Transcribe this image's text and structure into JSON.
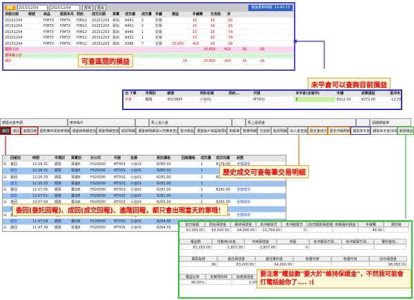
{
  "top": {
    "tag": "RE",
    "date1": "2015/12/04",
    "date2": "2015/12/04",
    "query": "查詢",
    "export": "匯出",
    "info": "最後更新時間: 12:40:13",
    "headers": [
      "淨額日期",
      "帳號",
      "商品",
      "期貨年月",
      "契約",
      "成交日期",
      "買賣",
      "成交價",
      "成交量",
      "手續",
      "損益",
      "手續費",
      "交易稅",
      "淨"
    ],
    "rows": [
      [
        "20151204",
        "",
        "FIMTX",
        "FIMTX",
        "FIM12",
        "20151203",
        "買出",
        "8441",
        "2",
        "交易",
        "",
        "15",
        "16",
        "-16"
      ],
      [
        "20151204",
        "",
        "FIMTX",
        "FIMTX",
        "FIM12",
        "20151203",
        "買出",
        "8451",
        "2",
        "交易",
        "",
        "15",
        "16",
        "-16"
      ],
      [
        "20151204",
        "",
        "FIMTX",
        "FIMTX",
        "FIM12",
        "20151203",
        "買出",
        "8440",
        "1",
        "交易",
        "",
        "15",
        "16",
        "-74"
      ],
      [
        "20151204",
        "",
        "FIMTX",
        "FIMTX",
        "FIM12",
        "20151203",
        "買出",
        "8422",
        "1",
        "交易",
        "",
        "15",
        "16",
        "-78"
      ],
      [
        "20151204",
        "",
        "FIMTX",
        "FIMTX",
        "FIM12",
        "20151203",
        "買出",
        "8386",
        "7",
        "交易",
        "25,650",
        "420",
        "16",
        "-16"
      ]
    ],
    "sub1": [
      "期貨小計",
      "25,650",
      "420",
      "16",
      "-16"
    ],
    "sub2": [
      "選擇權小計",
      "",
      "",
      "",
      ""
    ],
    "total": [
      "總計",
      "15",
      "25,650",
      "420",
      "16",
      "-16"
    ],
    "ann": "可查區間的損益"
  },
  "mid": {
    "ann": "未平倉可以查詢目前損益",
    "headers": [
      "功 下單",
      "市場別",
      "帳號",
      "契約名稱",
      "契約...",
      "代號",
      "未平倉(含當沖)",
      "市價",
      "試算損益",
      "當沖未..."
    ],
    "row": [
      "平倉",
      "期貨",
      "9033665",
      "小台01",
      "",
      "MTX01",
      "1",
      "8212.50",
      "8272.00",
      "-12,205.94"
    ]
  },
  "tabs": {
    "groups": [
      "期貨出金申請",
      "庫存帳戶",
      "",
      "馬上追入金",
      "",
      "馬上提領金",
      "",
      "週期期客庫"
    ],
    "items": [
      "委回",
      "成回",
      "進階回報",
      "匯款庫存與資券明細",
      "選委損明細查詢",
      "選委明細查詢",
      "期貨明細",
      "選委損明細與公司費率查詢",
      "當沖損益",
      "選委帳戶與提取預約",
      "對帳單",
      "數量明細",
      "交割款",
      "股票明細",
      "出入金查詢",
      "歷史委成交",
      "歷史沖銷明細",
      "期貨未平倉",
      "期貨未平倉DDE",
      "期貨權益"
    ]
  },
  "grid": {
    "headers": [
      "回報別",
      "時間",
      "市場別",
      "買賣別",
      "分公司",
      "代號",
      "名稱",
      "委託價格",
      "回報價格",
      "成交量",
      "成交均價",
      "狀態"
    ],
    "rows": [
      [
        "委回",
        "12:26:31",
        "期貨",
        "買進R",
        "F020000",
        "MTX01",
        "小台01",
        "8280.00",
        "",
        "1",
        "8279.00",
        "全部成交"
      ],
      [
        "成交",
        "12:26:31",
        "期貨",
        "買進B",
        "F020000",
        "MTX01",
        "小台01",
        "8280.00",
        "",
        "1",
        "",
        ""
      ],
      [
        "委回",
        "12:26:33",
        "期貨",
        "買進B",
        "F020000",
        "MTX01",
        "小台01",
        "8281.00",
        "",
        "1",
        "8279.00",
        "全部成交"
      ],
      [
        "成交",
        "12:26:33",
        "期貨",
        "買進B",
        "F020000",
        "MTX01",
        "小台01",
        "8281.00",
        "",
        "1",
        "",
        ""
      ],
      [
        "委回",
        "12:07:00",
        "期貨",
        "賣出B",
        "F020000",
        "MTX01",
        "小台01",
        "8281.00",
        "",
        "1",
        "8281.00",
        "全部成交"
      ],
      [
        "成交",
        "12:07:01",
        "期貨",
        "賣出B",
        "F020000",
        "MTX01",
        "小台01",
        "8281.00",
        "",
        "1",
        "",
        ""
      ],
      [
        "委回",
        "10:07:03",
        "期貨",
        "賣出B",
        "F020000",
        "MTX01",
        "小台01",
        "8265.00",
        "",
        "1",
        "8265.00",
        "全部成交"
      ],
      [
        "成交",
        "10:07:03",
        "期貨",
        "賣出B",
        "F020000",
        "MTX01",
        "小台01",
        "8265.00",
        "",
        "1",
        "",
        ""
      ],
      [
        "委回",
        "11:47:59",
        "期貨",
        "賣出B",
        "F020000",
        "MTX01",
        "小台01",
        "8264.00",
        "",
        "1",
        "8263.00",
        "全部成交"
      ],
      [
        "成交",
        "11:47:59",
        "期貨",
        "賣出B",
        "F020000",
        "MTX01",
        "小台01",
        "8264.00",
        "",
        "1",
        "",
        ""
      ],
      [
        "委回",
        "11:47:39",
        "期貨",
        "買進B",
        "F020000",
        "MTX01",
        "小台01",
        "8264.00",
        "",
        "1",
        "8264.00",
        "全部成交"
      ]
    ],
    "ann1": "歷史成交可查每筆交易明細",
    "ann2": "委回(委託回報)、成回(成交回報)、進階回報，都只會出現當天的單哦！"
  },
  "equity": {
    "h1": [
      "前日餘額",
      "原始保證金",
      "維持保證金",
      "未沖銷買方",
      "未沖銷賣方",
      "前日期貨保證金",
      "到期履約損益",
      "手續費",
      "期交稅"
    ],
    "v1": [
      "93,093.00",
      "83,000.00",
      "64,000.00",
      "-11,769.00",
      "0",
      "",
      "",
      "48.00",
      ""
    ],
    "h2": [
      "權益數",
      "可動用(出金...",
      "可用保證金",
      "存提",
      "未沖銷買方買...",
      "未沖銷賣方買...",
      "權利金收..."
    ],
    "v2": [
      "81,193.00",
      "-1,807.00",
      "-1,807.00",
      "0",
      "",
      "",
      ""
    ],
    "h3": [
      "風險指標",
      "委託保證金",
      "委託權利金",
      "有價可用",
      "有價可用",
      "前日保證金"
    ],
    "v3": [
      "96",
      "83,000.00",
      "64,000.00",
      "",
      "",
      "98,093.00"
    ],
    "h4": [
      "權益比率",
      "未實現利得",
      "加收保證金"
    ],
    "v4": [
      "96.00%",
      "",
      "0.00"
    ],
    "ann": "要注意\"權益數\"要大於\"維持保證金\"，不然我可能會打電話給你了.... :("
  }
}
